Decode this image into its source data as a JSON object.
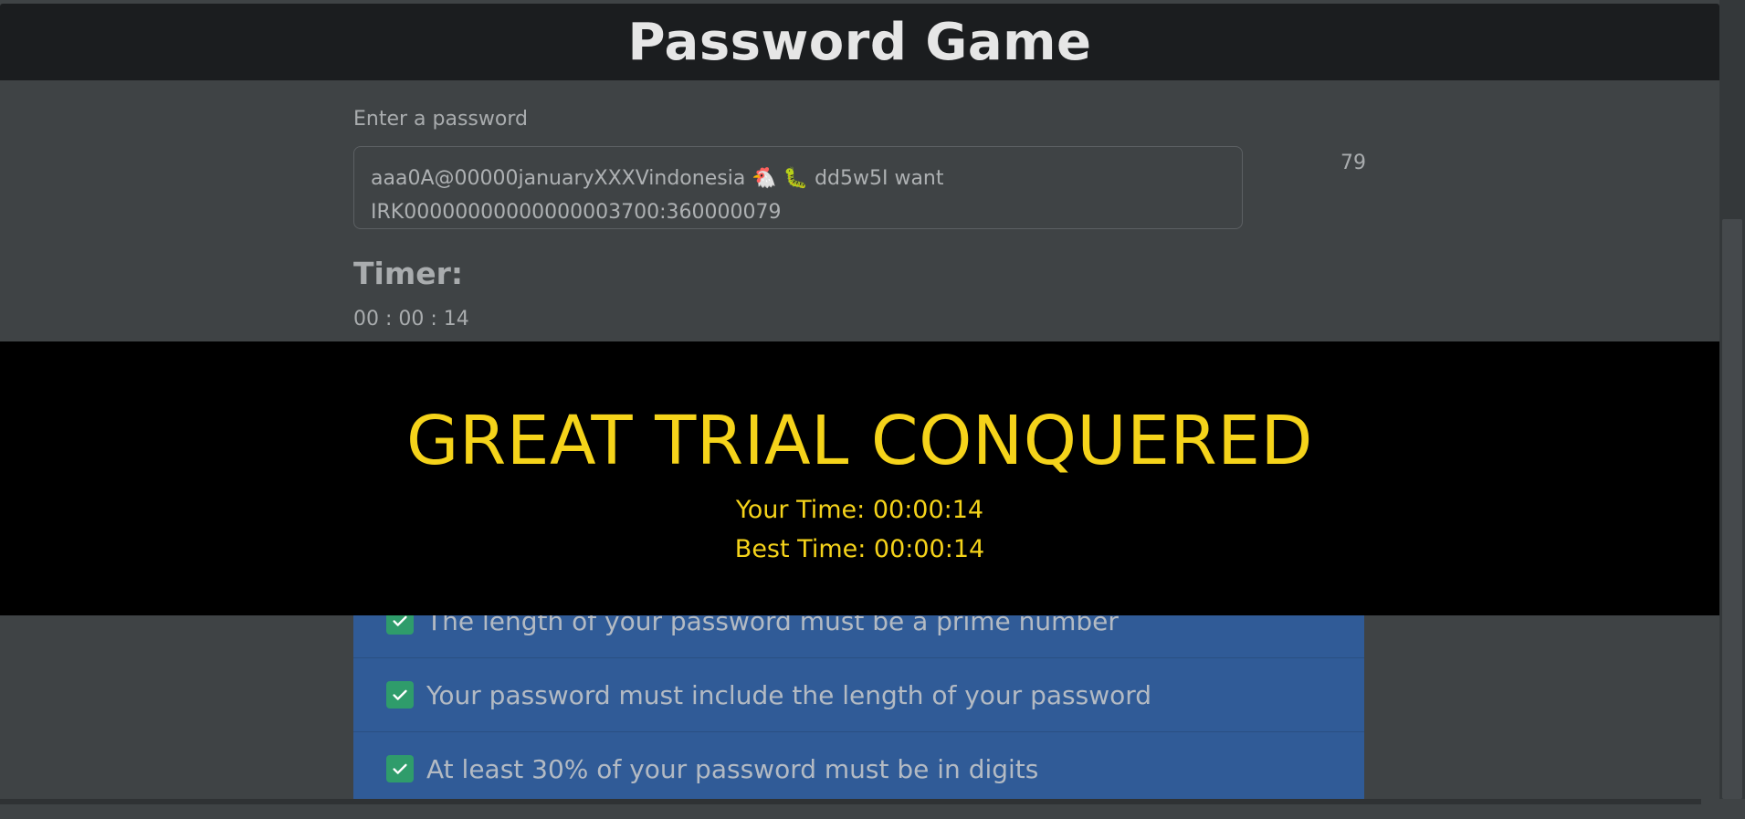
{
  "header": {
    "title": "Password Game"
  },
  "password": {
    "label": "Enter a password",
    "line1": "aaa0A@00000januaryXXXVindonesia 🐔 🐛 dd5w5I want",
    "line2": "IRK00000000000000003700:360000079",
    "char_count": "79"
  },
  "timer": {
    "title": "Timer:",
    "value": "00 : 00 : 14"
  },
  "overlay": {
    "title": "GREAT TRIAL CONQUERED",
    "your_time": "Your Time: 00:00:14",
    "best_time": "Best Time: 00:00:14",
    "color": "#f5d31a"
  },
  "rules": [
    {
      "text": "The length of your password must be a prime number",
      "satisfied": true
    },
    {
      "text": "Your password must include the length of your password",
      "satisfied": true
    },
    {
      "text": "At least 30% of your password must be in digits",
      "satisfied": true
    }
  ],
  "colors": {
    "rule_bg": "#305b97",
    "check_bg": "#2f9c6b",
    "header_bg": "#1b1d1f"
  }
}
